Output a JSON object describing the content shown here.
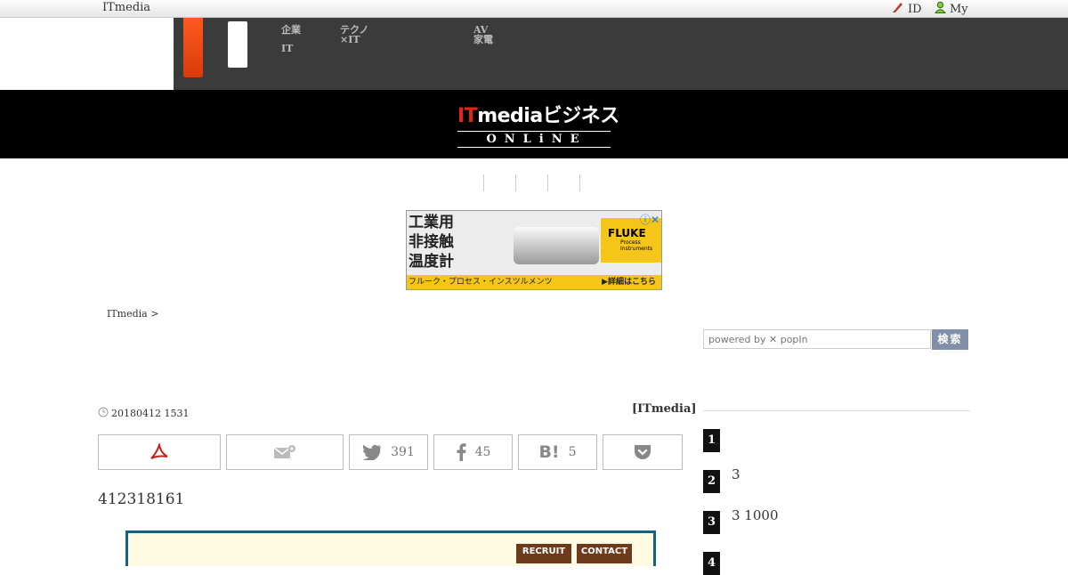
{
  "topbar": {
    "brand": "ITmedia",
    "id_label": "ID",
    "my_label": "My"
  },
  "nav": {
    "categories": [
      {
        "line1": "企業",
        "line2": "IT"
      },
      {
        "line1": "テクノ",
        "line2": "×IT"
      },
      {
        "line1": "AV",
        "line2": "家電"
      }
    ]
  },
  "logo": {
    "it": "IT",
    "media": "media",
    "biz": "ビジネス",
    "online": "ONLiNE"
  },
  "ad": {
    "lines": [
      "工業用",
      "非接触",
      "温度計"
    ],
    "brand": "FLUKE",
    "brand_sub": "Process Instruments",
    "footer_left": "フルーク・プロセス・インスツルメンツ",
    "footer_right": "▶詳細はこちら"
  },
  "breadcrumb": "ITmedia  >",
  "search": {
    "placeholder": "powered by ✕ popIn",
    "button": "検索"
  },
  "article": {
    "date": "20180412 1531",
    "byline": "[ITmedia]",
    "lead": "412318161",
    "img_buttons": [
      "RECRUIT",
      "CONTACT"
    ]
  },
  "share": {
    "twitter_count": "391",
    "facebook_count": "45",
    "hatena_count": "5"
  },
  "ranking": [
    {
      "num": "1",
      "text": ""
    },
    {
      "num": "2",
      "text": "3"
    },
    {
      "num": "3",
      "text": "3 1000"
    },
    {
      "num": "4",
      "text": ""
    }
  ]
}
